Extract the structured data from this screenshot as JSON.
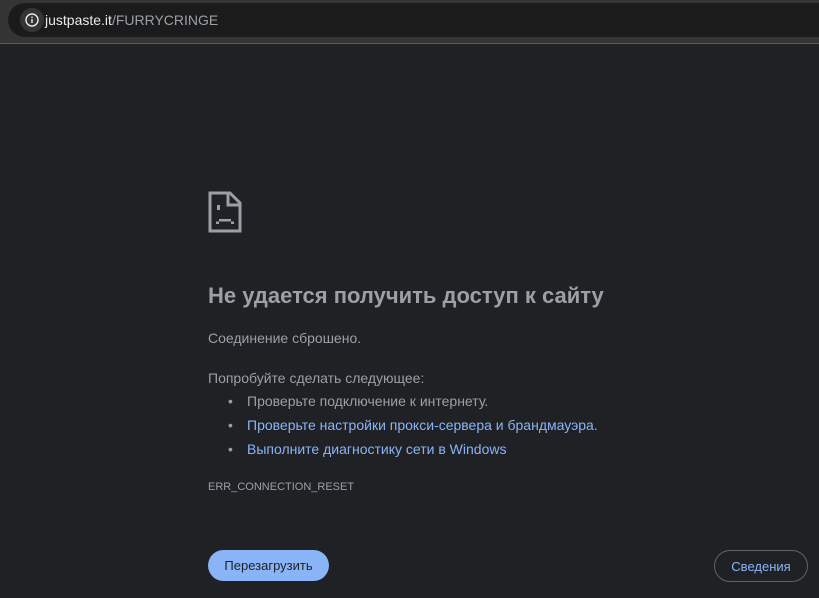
{
  "browser": {
    "url_host": "justpaste.it",
    "url_path": "/FURRYCRINGE",
    "info_icon": "info-icon"
  },
  "error": {
    "icon": "sad-page-icon",
    "title": "Не удается получить доступ к сайту",
    "subtitle": "Соединение сброшено.",
    "try_label": "Попробуйте сделать следующее:",
    "suggestions": [
      {
        "text": "Проверьте подключение к интернету.",
        "link": false
      },
      {
        "text": "Проверьте настройки прокси-сервера и брандмауэра.",
        "link": true
      },
      {
        "text": "Выполните диагностику сети в Windows",
        "link": true
      }
    ],
    "code": "ERR_CONNECTION_RESET",
    "reload_label": "Перезагрузить",
    "details_label": "Сведения"
  },
  "colors": {
    "accent": "#8ab4f8",
    "background": "#202124",
    "text": "#9aa0a6"
  }
}
